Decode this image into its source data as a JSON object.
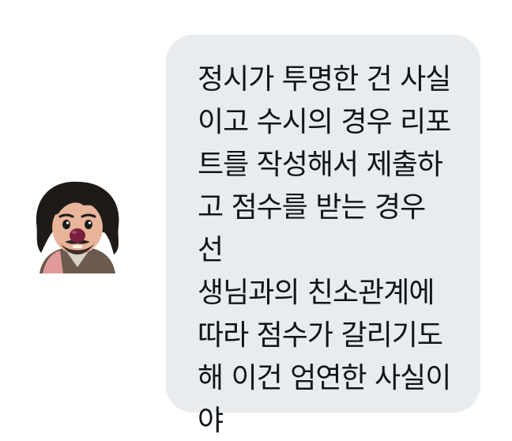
{
  "message": {
    "text": "정시가 투명한 건 사실\n이고 수시의 경우 리포\n트를 작성해서 제출하\n고 점수를 받는 경우 선\n생님과의 친소관계에\n따라 점수가 갈리기도\n해 이건 엄연한 사실이\n야",
    "bubble_color": "#e8ecef"
  },
  "sender": {
    "avatar_icon": "cartoon-avatar-icon"
  }
}
